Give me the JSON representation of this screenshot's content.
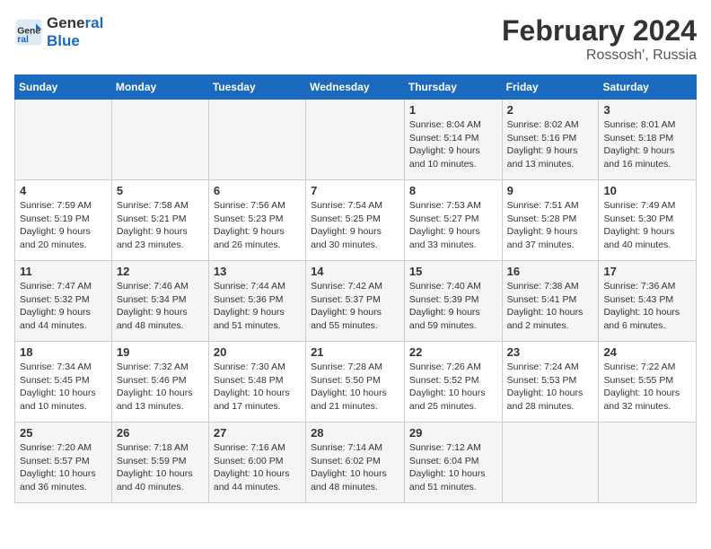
{
  "header": {
    "logo_line1": "General",
    "logo_line2": "Blue",
    "month_title": "February 2024",
    "subtitle": "Rossosh', Russia"
  },
  "days_of_week": [
    "Sunday",
    "Monday",
    "Tuesday",
    "Wednesday",
    "Thursday",
    "Friday",
    "Saturday"
  ],
  "weeks": [
    [
      {
        "day": "",
        "info": ""
      },
      {
        "day": "",
        "info": ""
      },
      {
        "day": "",
        "info": ""
      },
      {
        "day": "",
        "info": ""
      },
      {
        "day": "1",
        "info": "Sunrise: 8:04 AM\nSunset: 5:14 PM\nDaylight: 9 hours\nand 10 minutes."
      },
      {
        "day": "2",
        "info": "Sunrise: 8:02 AM\nSunset: 5:16 PM\nDaylight: 9 hours\nand 13 minutes."
      },
      {
        "day": "3",
        "info": "Sunrise: 8:01 AM\nSunset: 5:18 PM\nDaylight: 9 hours\nand 16 minutes."
      }
    ],
    [
      {
        "day": "4",
        "info": "Sunrise: 7:59 AM\nSunset: 5:19 PM\nDaylight: 9 hours\nand 20 minutes."
      },
      {
        "day": "5",
        "info": "Sunrise: 7:58 AM\nSunset: 5:21 PM\nDaylight: 9 hours\nand 23 minutes."
      },
      {
        "day": "6",
        "info": "Sunrise: 7:56 AM\nSunset: 5:23 PM\nDaylight: 9 hours\nand 26 minutes."
      },
      {
        "day": "7",
        "info": "Sunrise: 7:54 AM\nSunset: 5:25 PM\nDaylight: 9 hours\nand 30 minutes."
      },
      {
        "day": "8",
        "info": "Sunrise: 7:53 AM\nSunset: 5:27 PM\nDaylight: 9 hours\nand 33 minutes."
      },
      {
        "day": "9",
        "info": "Sunrise: 7:51 AM\nSunset: 5:28 PM\nDaylight: 9 hours\nand 37 minutes."
      },
      {
        "day": "10",
        "info": "Sunrise: 7:49 AM\nSunset: 5:30 PM\nDaylight: 9 hours\nand 40 minutes."
      }
    ],
    [
      {
        "day": "11",
        "info": "Sunrise: 7:47 AM\nSunset: 5:32 PM\nDaylight: 9 hours\nand 44 minutes."
      },
      {
        "day": "12",
        "info": "Sunrise: 7:46 AM\nSunset: 5:34 PM\nDaylight: 9 hours\nand 48 minutes."
      },
      {
        "day": "13",
        "info": "Sunrise: 7:44 AM\nSunset: 5:36 PM\nDaylight: 9 hours\nand 51 minutes."
      },
      {
        "day": "14",
        "info": "Sunrise: 7:42 AM\nSunset: 5:37 PM\nDaylight: 9 hours\nand 55 minutes."
      },
      {
        "day": "15",
        "info": "Sunrise: 7:40 AM\nSunset: 5:39 PM\nDaylight: 9 hours\nand 59 minutes."
      },
      {
        "day": "16",
        "info": "Sunrise: 7:38 AM\nSunset: 5:41 PM\nDaylight: 10 hours\nand 2 minutes."
      },
      {
        "day": "17",
        "info": "Sunrise: 7:36 AM\nSunset: 5:43 PM\nDaylight: 10 hours\nand 6 minutes."
      }
    ],
    [
      {
        "day": "18",
        "info": "Sunrise: 7:34 AM\nSunset: 5:45 PM\nDaylight: 10 hours\nand 10 minutes."
      },
      {
        "day": "19",
        "info": "Sunrise: 7:32 AM\nSunset: 5:46 PM\nDaylight: 10 hours\nand 13 minutes."
      },
      {
        "day": "20",
        "info": "Sunrise: 7:30 AM\nSunset: 5:48 PM\nDaylight: 10 hours\nand 17 minutes."
      },
      {
        "day": "21",
        "info": "Sunrise: 7:28 AM\nSunset: 5:50 PM\nDaylight: 10 hours\nand 21 minutes."
      },
      {
        "day": "22",
        "info": "Sunrise: 7:26 AM\nSunset: 5:52 PM\nDaylight: 10 hours\nand 25 minutes."
      },
      {
        "day": "23",
        "info": "Sunrise: 7:24 AM\nSunset: 5:53 PM\nDaylight: 10 hours\nand 28 minutes."
      },
      {
        "day": "24",
        "info": "Sunrise: 7:22 AM\nSunset: 5:55 PM\nDaylight: 10 hours\nand 32 minutes."
      }
    ],
    [
      {
        "day": "25",
        "info": "Sunrise: 7:20 AM\nSunset: 5:57 PM\nDaylight: 10 hours\nand 36 minutes."
      },
      {
        "day": "26",
        "info": "Sunrise: 7:18 AM\nSunset: 5:59 PM\nDaylight: 10 hours\nand 40 minutes."
      },
      {
        "day": "27",
        "info": "Sunrise: 7:16 AM\nSunset: 6:00 PM\nDaylight: 10 hours\nand 44 minutes."
      },
      {
        "day": "28",
        "info": "Sunrise: 7:14 AM\nSunset: 6:02 PM\nDaylight: 10 hours\nand 48 minutes."
      },
      {
        "day": "29",
        "info": "Sunrise: 7:12 AM\nSunset: 6:04 PM\nDaylight: 10 hours\nand 51 minutes."
      },
      {
        "day": "",
        "info": ""
      },
      {
        "day": "",
        "info": ""
      }
    ]
  ]
}
